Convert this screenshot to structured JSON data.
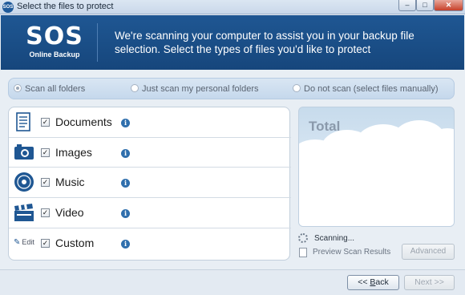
{
  "window": {
    "title": "Select the files to protect",
    "icon_text": "SOS"
  },
  "header": {
    "logo_main": "SOS",
    "logo_sub": "Online Backup",
    "message": "We're scanning your computer to assist you in your backup file selection. Select the types of files you'd like to protect"
  },
  "scan_options": [
    {
      "label": "Scan all folders",
      "selected": true
    },
    {
      "label": "Just scan my personal folders",
      "selected": false
    },
    {
      "label": "Do not scan (select files manually)",
      "selected": false
    }
  ],
  "file_types": [
    {
      "label": "Documents",
      "checked": true,
      "icon": "document-icon"
    },
    {
      "label": "Images",
      "checked": true,
      "icon": "camera-icon"
    },
    {
      "label": "Music",
      "checked": true,
      "icon": "music-disc-icon"
    },
    {
      "label": "Video",
      "checked": true,
      "icon": "clapperboard-icon"
    },
    {
      "label": "Custom",
      "checked": true,
      "icon": "edit-icon",
      "edit_label": "Edit"
    }
  ],
  "info_glyph": "i",
  "check_glyph": "✓",
  "total": {
    "label": "Total"
  },
  "status": {
    "scanning": "Scanning...",
    "preview": "Preview Scan Results"
  },
  "buttons": {
    "advanced": "Advanced",
    "back_arrows": "<< ",
    "back_key": "B",
    "back_rest": "ack",
    "next": "Next >>"
  },
  "colors": {
    "header_bg": "#1f5793",
    "accent": "#2f6fad"
  }
}
